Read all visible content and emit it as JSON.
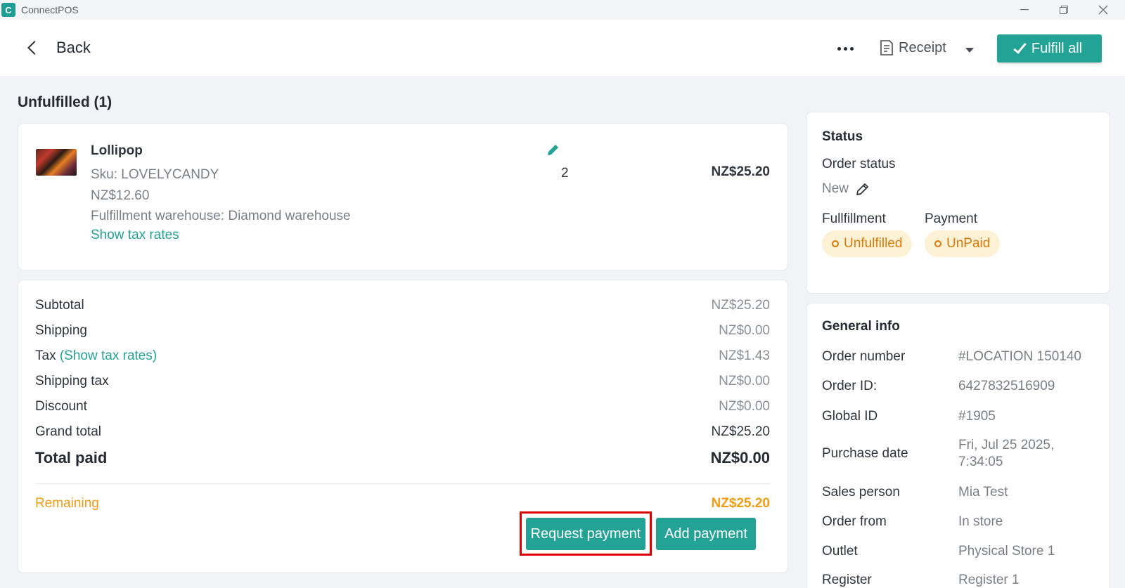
{
  "window": {
    "app_title": "ConnectPOS",
    "logo_glyph": "C"
  },
  "topbar": {
    "back_label": "Back",
    "receipt_label": "Receipt",
    "fulfill_label": "Fulfill all"
  },
  "section": {
    "title": "Unfulfilled (1)"
  },
  "product": {
    "name": "Lollipop",
    "sku": "Sku: LOVELYCANDY",
    "unit_price": "NZ$12.60",
    "warehouse": "Fulfillment warehouse: Diamond warehouse",
    "tax_link": "Show tax rates",
    "qty": "2",
    "total": "NZ$25.20"
  },
  "totals": {
    "subtotal_label": "Subtotal",
    "subtotal_value": "NZ$25.20",
    "shipping_label": "Shipping",
    "shipping_value": "NZ$0.00",
    "tax_label": "Tax",
    "tax_link": "(Show tax rates)",
    "tax_value": "NZ$1.43",
    "shipping_tax_label": "Shipping tax",
    "shipping_tax_value": "NZ$0.00",
    "discount_label": "Discount",
    "discount_value": "NZ$0.00",
    "grand_total_label": "Grand total",
    "grand_total_value": "NZ$25.20",
    "total_paid_label": "Total paid",
    "total_paid_value": "NZ$0.00",
    "remaining_label": "Remaining",
    "remaining_value": "NZ$25.20",
    "request_payment_label": "Request payment",
    "add_payment_label": "Add payment"
  },
  "status": {
    "title": "Status",
    "order_status_label": "Order status",
    "order_status_value": "New",
    "fulfillment_label": "Fullfillment",
    "fulfillment_value": "Unfulfilled",
    "payment_label": "Payment",
    "payment_value": "UnPaid"
  },
  "general": {
    "title": "General info",
    "order_number_label": "Order number",
    "order_number_value": "#LOCATION 150140",
    "order_id_label": "Order ID:",
    "order_id_value": "6427832516909",
    "global_id_label": "Global ID",
    "global_id_value": "#1905",
    "purchase_date_label": "Purchase date",
    "purchase_date_line1": "Fri, Jul 25 2025,",
    "purchase_date_line2": "7:34:05",
    "sales_person_label": "Sales person",
    "sales_person_value": "Mia Test",
    "order_from_label": "Order from",
    "order_from_value": "In store",
    "outlet_label": "Outlet",
    "outlet_value": "Physical Store 1",
    "register_label": "Register",
    "register_value": "Register 1"
  },
  "colors": {
    "accent": "#23a396",
    "warning": "#f39c12",
    "highlight": "#e00000"
  }
}
